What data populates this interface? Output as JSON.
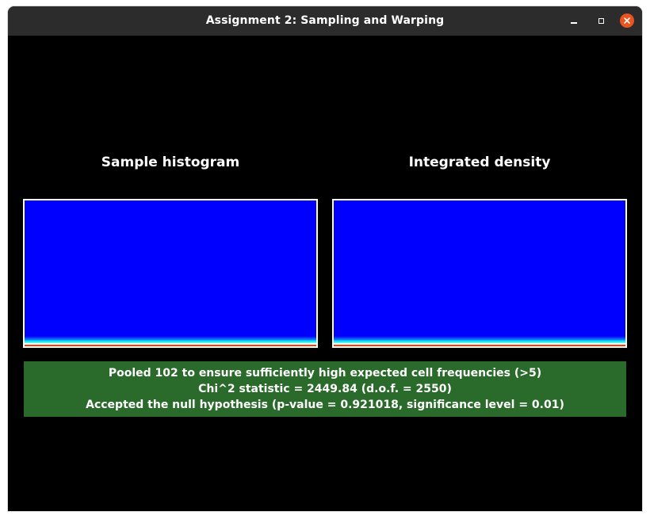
{
  "window": {
    "title": "Assignment 2: Sampling and Warping",
    "controls": {
      "minimize_icon": "minimize-icon",
      "maximize_icon": "maximize-icon",
      "close_icon": "close-icon",
      "close_color": "#e95420"
    }
  },
  "panels": {
    "left": {
      "title": "Sample histogram"
    },
    "right": {
      "title": "Integrated density"
    }
  },
  "colormap": {
    "base": "#0000ff",
    "bottom_rows": [
      "#0a2cff",
      "#0070ff",
      "#00c8ff",
      "#40ffe0",
      "#ffffff",
      "#ff3a00"
    ]
  },
  "result": {
    "background": "#2a6a2a",
    "lines": [
      "Pooled 102 to ensure sufficiently high expected cell frequencies (>5)",
      "Chi^2 statistic = 2449.84 (d.o.f. = 2550)",
      "Accepted the null hypothesis (p-value = 0.921018, significance level = 0.01)"
    ]
  }
}
